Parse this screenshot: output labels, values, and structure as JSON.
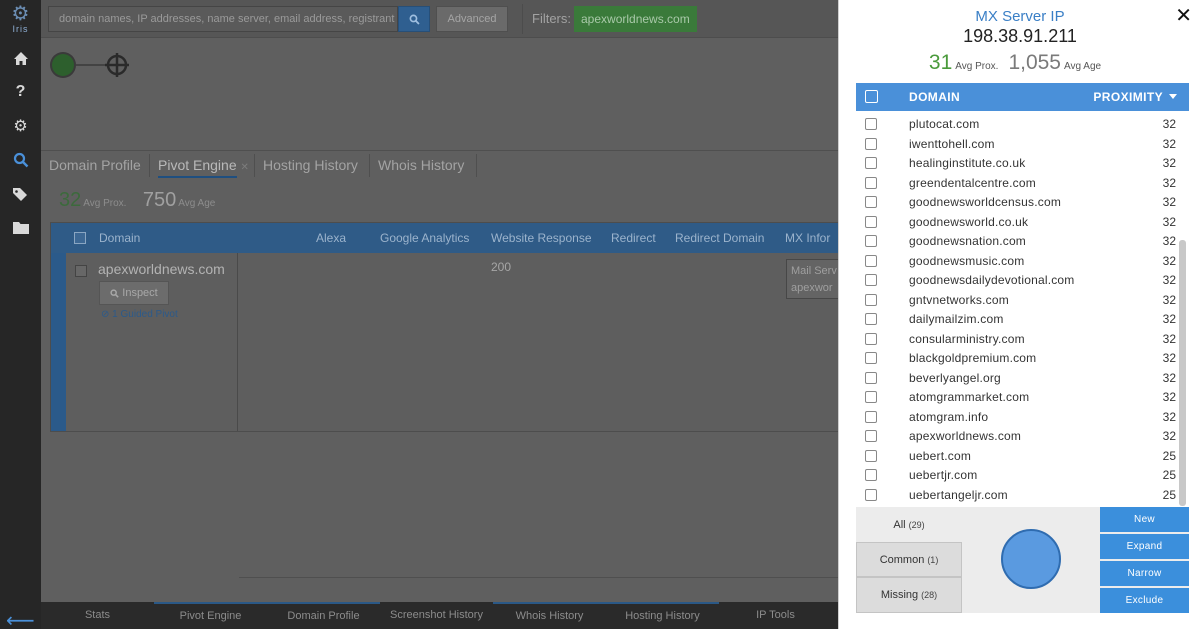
{
  "rail": {
    "logo_word": "Iris",
    "icons": [
      "home-icon",
      "help-icon",
      "gear-icon",
      "search-icon",
      "tags-icon",
      "folder-icon"
    ]
  },
  "topbar": {
    "search_placeholder": "domain names, IP addresses, name server, email address, registrant name",
    "advanced_label": "Advanced",
    "filters_label": "Filters:",
    "filter_chip": "apexworldnews.com"
  },
  "tabs": [
    {
      "label": "Domain Profile",
      "active": false
    },
    {
      "label": "Pivot Engine",
      "active": true
    },
    {
      "label": "Hosting History",
      "active": false
    },
    {
      "label": "Whois History",
      "active": false
    }
  ],
  "main_stats": {
    "prox_value": "32",
    "prox_label": "Avg Prox.",
    "age_value": "750",
    "age_label": "Avg Age"
  },
  "grid": {
    "columns": [
      "Domain",
      "Alexa",
      "Google Analytics",
      "Website Response",
      "Redirect",
      "Redirect Domain",
      "MX Infor"
    ],
    "row": {
      "domain": "apexworldnews.com",
      "inspect_label": "Inspect",
      "guided_pivot": "1 Guided Pivot",
      "website_response": "200",
      "mx_line1": "Mail Serv",
      "mx_line2": "apexwor"
    }
  },
  "bottom_tabs": [
    "Stats",
    "Pivot Engine",
    "Domain Profile",
    "Screenshot History",
    "Whois History",
    "Hosting History",
    "IP Tools"
  ],
  "panel": {
    "title": "MX Server IP",
    "ip": "198.38.91.211",
    "avg_prox_value": "31",
    "avg_prox_label": "Avg Prox.",
    "avg_age_value": "1,055",
    "avg_age_label": "Avg Age",
    "col_domain": "DOMAIN",
    "col_proximity": "PROXIMITY",
    "rows": [
      {
        "domain": "plutocat.com",
        "prox": "32"
      },
      {
        "domain": "iwenttohell.com",
        "prox": "32"
      },
      {
        "domain": "healinginstitute.co.uk",
        "prox": "32"
      },
      {
        "domain": "greendentalcentre.com",
        "prox": "32"
      },
      {
        "domain": "goodnewsworldcensus.com",
        "prox": "32"
      },
      {
        "domain": "goodnewsworld.co.uk",
        "prox": "32"
      },
      {
        "domain": "goodnewsnation.com",
        "prox": "32"
      },
      {
        "domain": "goodnewsmusic.com",
        "prox": "32"
      },
      {
        "domain": "goodnewsdailydevotional.com",
        "prox": "32"
      },
      {
        "domain": "gntvnetworks.com",
        "prox": "32"
      },
      {
        "domain": "dailymailzim.com",
        "prox": "32"
      },
      {
        "domain": "consularministry.com",
        "prox": "32"
      },
      {
        "domain": "blackgoldpremium.com",
        "prox": "32"
      },
      {
        "domain": "beverlyangel.org",
        "prox": "32"
      },
      {
        "domain": "atomgrammarket.com",
        "prox": "32"
      },
      {
        "domain": "atomgram.info",
        "prox": "32"
      },
      {
        "domain": "apexworldnews.com",
        "prox": "32"
      },
      {
        "domain": "uebert.com",
        "prox": "25"
      },
      {
        "domain": "uebertjr.com",
        "prox": "25"
      },
      {
        "domain": "uebertangeljr.com",
        "prox": "25"
      }
    ],
    "venn_tabs": [
      {
        "label": "All",
        "count": "(29)"
      },
      {
        "label": "Common",
        "count": "(1)"
      },
      {
        "label": "Missing",
        "count": "(28)"
      }
    ],
    "actions": [
      "New",
      "Expand",
      "Narrow",
      "Exclude"
    ]
  }
}
